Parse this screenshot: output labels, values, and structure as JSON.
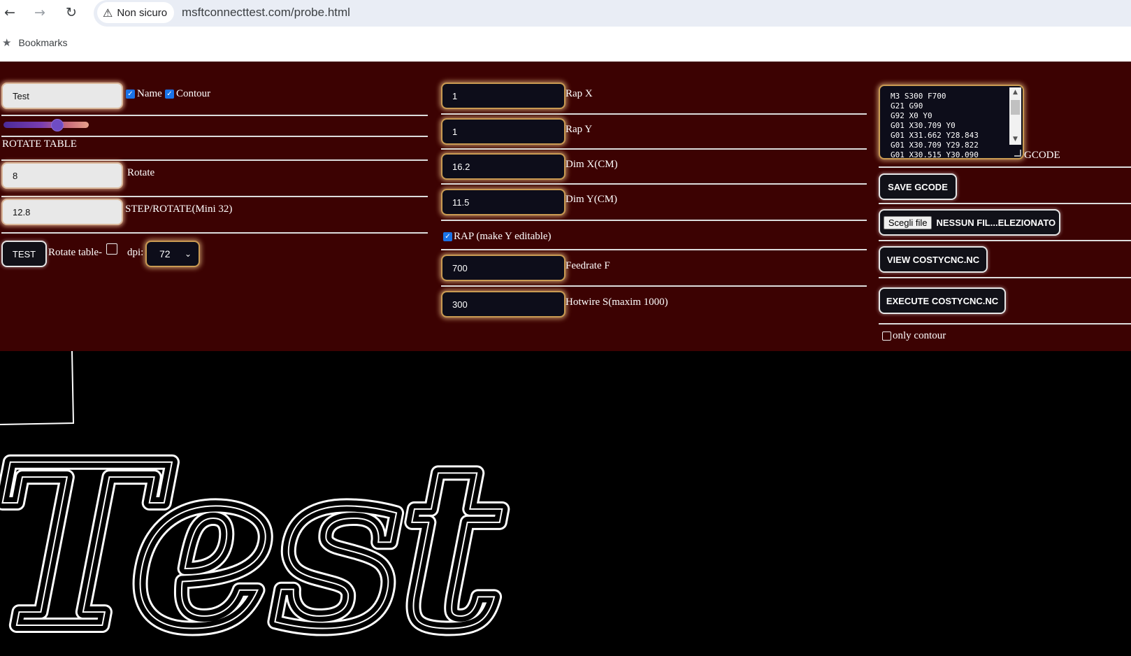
{
  "browser": {
    "security_label": "Non sicuro",
    "url": "msftconnecttest.com/probe.html",
    "bookmarks_label": "Bookmarks"
  },
  "left": {
    "name_input": "Test",
    "name_checkbox_label": "Name",
    "name_checked": true,
    "contour_checkbox_label": "Contour",
    "contour_checked": true,
    "slider_level_percent": 63,
    "rotate_table_heading": "ROTATE TABLE",
    "rotate_value": "8",
    "rotate_label": "Rotate",
    "step_value": "12.8",
    "step_label": "STEP/ROTATE(Mini 32)",
    "test_button": "TEST",
    "rotate_table_checkbox_label": "Rotate table-",
    "rotate_table_checked": false,
    "dpi_label": "dpi:",
    "dpi_value": "72"
  },
  "middle": {
    "rap_x_value": "1",
    "rap_x_label": "Rap X",
    "rap_y_value": "1",
    "rap_y_label": "Rap Y",
    "dim_x_value": "16.2",
    "dim_x_label": "Dim X(CM)",
    "dim_y_value": "11.5",
    "dim_y_label": "Dim Y(CM)",
    "rap_checkbox_label": "RAP (make Y editable)",
    "rap_checked": true,
    "feedrate_value": "700",
    "feedrate_label": "Feedrate F",
    "hotwire_value": "300",
    "hotwire_label": "Hotwire S(maxim 1000)"
  },
  "right": {
    "gcode_text": "M3 S300 F700\nG21 G90\nG92 X0 Y0\nG01 X30.709 Y0\nG01 X31.662 Y28.843\nG01 X30.709 Y29.822\nG01 X30.515 Y30.090",
    "gcode_label": "GCODE",
    "save_button": "SAVE GCODE",
    "file_choose_button": "Scegli file",
    "file_status": "NESSUN FIL...ELEZIONATO",
    "view_button": "VIEW COSTYCNC.NC",
    "execute_button": "EXECUTE COSTYCNC.NC",
    "only_contour_label": "only contour",
    "only_contour_checked": false
  },
  "canvas": {
    "text": "Test"
  },
  "colors": {
    "panel_bg": "#3c0202",
    "canvas_bg": "#000000",
    "accent_border": "#c99a52",
    "checkbox_blue": "#1a73e8",
    "omnibox_bg": "#e9edf5"
  },
  "icons": [
    "back-arrow-icon",
    "forward-arrow-icon",
    "reload-icon",
    "warning-triangle-icon",
    "star-icon",
    "checkmark-icon",
    "chevron-down-icon"
  ]
}
